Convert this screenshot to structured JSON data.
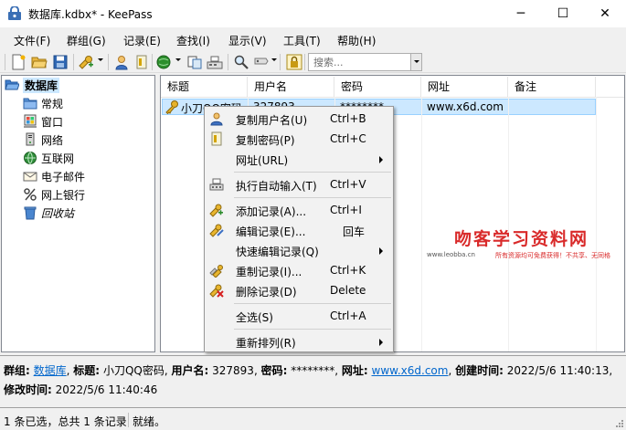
{
  "window": {
    "title": "数据库.kdbx* - KeePass",
    "minimize_glyph": "─",
    "maximize_glyph": "☐",
    "close_glyph": "✕"
  },
  "menu": [
    "文件(F)",
    "群组(G)",
    "记录(E)",
    "查找(I)",
    "显示(V)",
    "工具(T)",
    "帮助(H)"
  ],
  "toolbar": {
    "icons": [
      "new-database-icon",
      "open-database-icon",
      "save-icon",
      "add-entry-icon",
      "copy-username-icon",
      "copy-password-icon",
      "open-url-icon",
      "copy-entry-icon",
      "autotype-icon",
      "find-icon",
      "entry-view-icon",
      "lock-workspace-icon"
    ],
    "search_placeholder": "搜索..."
  },
  "groups": {
    "root": "数据库",
    "children": [
      "常规",
      "窗口",
      "网络",
      "互联网",
      "电子邮件",
      "网上银行",
      "回收站"
    ]
  },
  "table": {
    "columns": [
      "标题",
      "用户名",
      "密码",
      "网址",
      "备注"
    ],
    "rows": [
      {
        "title": "小刀QQ密码",
        "username": "327893",
        "password": "********",
        "url": "www.x6d.com",
        "notes": ""
      }
    ]
  },
  "context_menu": {
    "items": [
      {
        "label": "复制用户名(U)",
        "shortcut": "Ctrl+B",
        "icon": "user-icon"
      },
      {
        "label": "复制密码(P)",
        "shortcut": "Ctrl+C",
        "icon": "key-card-icon"
      },
      {
        "label": "网址(URL)",
        "shortcut": "",
        "icon": "",
        "submenu": true
      },
      {
        "label": "执行自动输入(T)",
        "shortcut": "Ctrl+V",
        "icon": "autotype-icon"
      },
      {
        "label": "添加记录(A)...",
        "shortcut": "Ctrl+I",
        "icon": "add-entry-icon"
      },
      {
        "label": "编辑记录(E)...",
        "shortcut": "回车",
        "icon": "edit-entry-icon"
      },
      {
        "label": "快速编辑记录(Q)",
        "shortcut": "",
        "icon": "",
        "submenu": true
      },
      {
        "label": "重制记录(I)...",
        "shortcut": "Ctrl+K",
        "icon": "duplicate-entry-icon"
      },
      {
        "label": "删除记录(D)",
        "shortcut": "Delete",
        "icon": "delete-entry-icon"
      },
      {
        "label": "全选(S)",
        "shortcut": "Ctrl+A",
        "icon": ""
      },
      {
        "label": "重新排列(R)",
        "shortcut": "",
        "icon": "",
        "submenu": true
      }
    ]
  },
  "details": {
    "group_label": "群组:",
    "group_value": "数据库",
    "title_label": "标题:",
    "title_value": "小刀QQ密码",
    "username_label": "用户名:",
    "username_value": "327893",
    "password_label": "密码:",
    "password_value": "********",
    "url_label": "网址:",
    "url_value": "www.x6d.com",
    "created_label": "创建时间:",
    "created_value": "2022/5/6 11:40:13",
    "modified_label": "修改时间:",
    "modified_value": "2022/5/6 11:40:46"
  },
  "status": {
    "selection": "1 条已选，总共 1 条记录",
    "state": "就绪。"
  },
  "watermark": {
    "main": "吻客学习资料网",
    "site": "www.leobba.cn",
    "slogan": "所有资源均可免费获得！不共享、无同格"
  },
  "colors": {
    "selection": "#cce8ff",
    "link": "#0066cc",
    "watermark_red": "#d92a2a"
  }
}
